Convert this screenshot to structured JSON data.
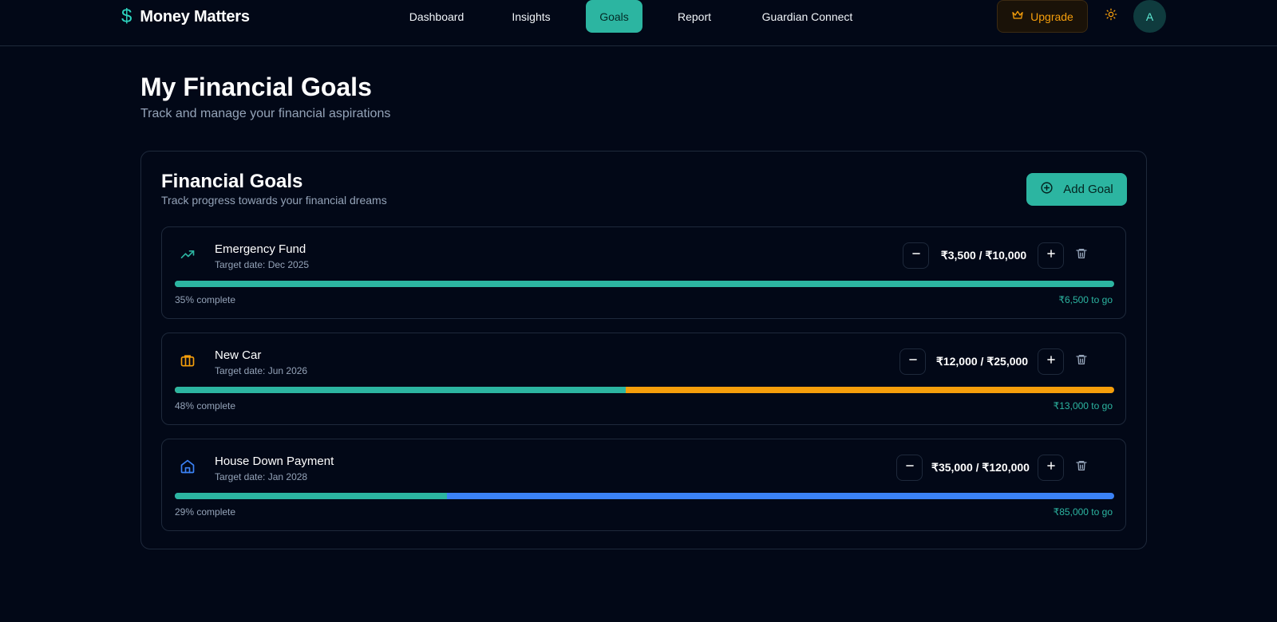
{
  "brand": {
    "name": "Money Matters",
    "icon": "dollar-icon",
    "color": "#2dd4bf"
  },
  "nav": {
    "items": [
      {
        "label": "Dashboard",
        "active": false
      },
      {
        "label": "Insights",
        "active": false
      },
      {
        "label": "Goals",
        "active": true
      },
      {
        "label": "Report",
        "active": false
      },
      {
        "label": "Guardian Connect",
        "active": false
      }
    ],
    "active_color": "#2cb5a1"
  },
  "header": {
    "upgrade_label": "Upgrade",
    "upgrade_icon": "crown-icon",
    "theme_icon": "sun-icon",
    "avatar_initial": "A"
  },
  "page": {
    "title": "My Financial Goals",
    "subtitle": "Track and manage your financial aspirations"
  },
  "goals_card": {
    "title": "Financial Goals",
    "subtitle": "Track progress towards your financial dreams",
    "add_label": "Add Goal",
    "add_icon": "plus-circle-icon"
  },
  "goals": [
    {
      "name": "Emergency Fund",
      "target_date": "Target date: Dec 2025",
      "amount": "₹3,500 / ₹10,000",
      "percent_label": "35% complete",
      "to_go": "₹6,500 to go",
      "progress": 0.35,
      "icon": "trending-up-icon",
      "icon_color": "#2cb5a1",
      "track_color": "#2cb5a1"
    },
    {
      "name": "New Car",
      "target_date": "Target date: Jun 2026",
      "amount": "₹12,000 / ₹25,000",
      "percent_label": "48% complete",
      "to_go": "₹13,000 to go",
      "progress": 0.48,
      "icon": "briefcase-icon",
      "icon_color": "#f59e0b",
      "track_color": "#f59e0b"
    },
    {
      "name": "House Down Payment",
      "target_date": "Target date: Jan 2028",
      "amount": "₹35,000 / ₹120,000",
      "percent_label": "29% complete",
      "to_go": "₹85,000 to go",
      "progress": 0.29,
      "icon": "home-icon",
      "icon_color": "#3b82f6",
      "track_color": "#3b82f6"
    }
  ]
}
